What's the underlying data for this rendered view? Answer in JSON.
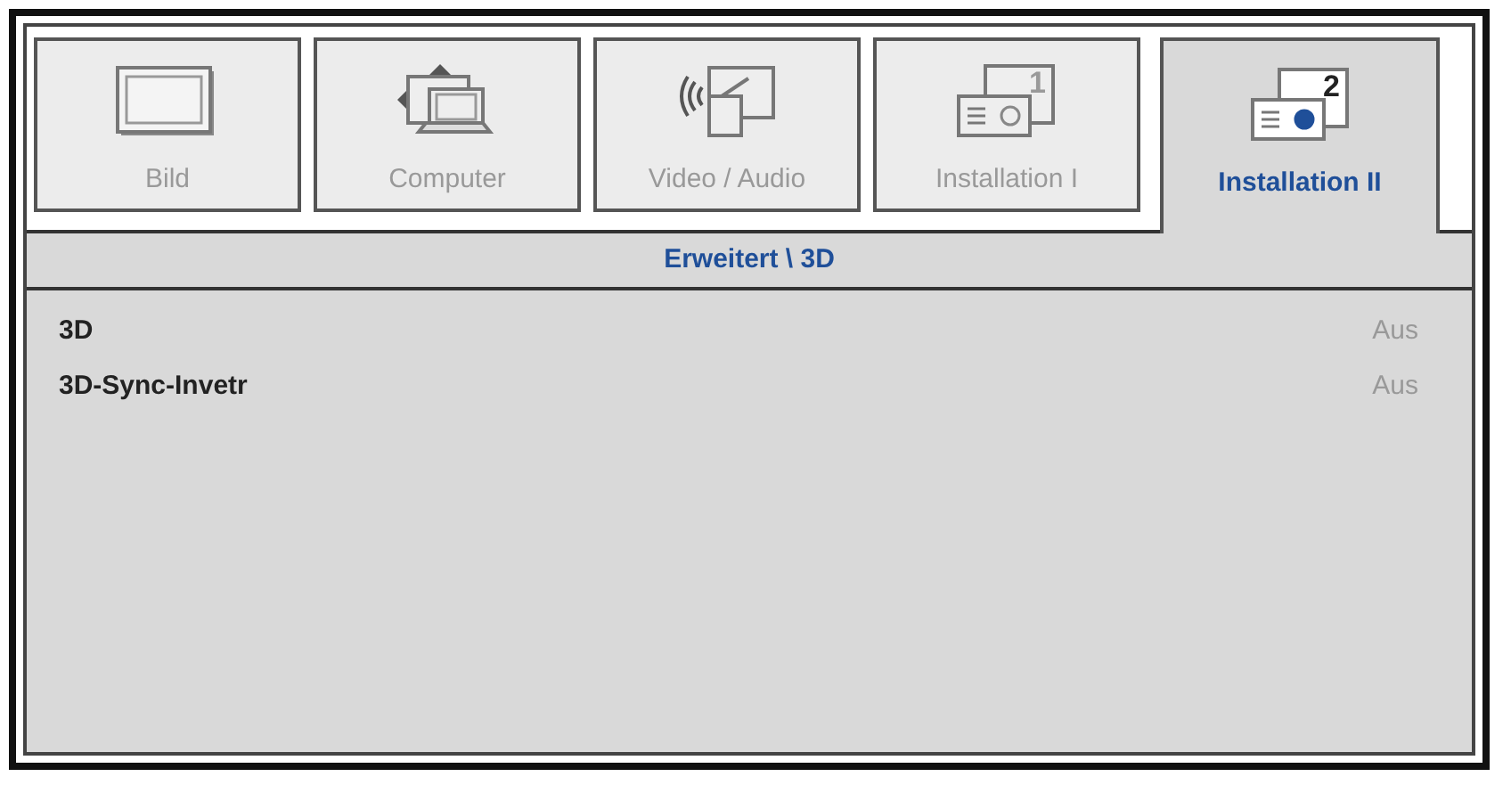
{
  "tabs": [
    {
      "label": "Bild",
      "kind": "picture",
      "selected": false
    },
    {
      "label": "Computer",
      "kind": "computer",
      "selected": false
    },
    {
      "label": "Video / Audio",
      "kind": "video",
      "selected": false
    },
    {
      "label": "Installation I",
      "kind": "install",
      "badge": "1",
      "selected": false
    },
    {
      "label": "Installation II",
      "kind": "install",
      "badge": "2",
      "selected": true
    }
  ],
  "header": "Erweitert \\ 3D",
  "rows": [
    {
      "label": "3D",
      "value": "Aus"
    },
    {
      "label": "3D-Sync-Invetr",
      "value": "Aus"
    }
  ]
}
